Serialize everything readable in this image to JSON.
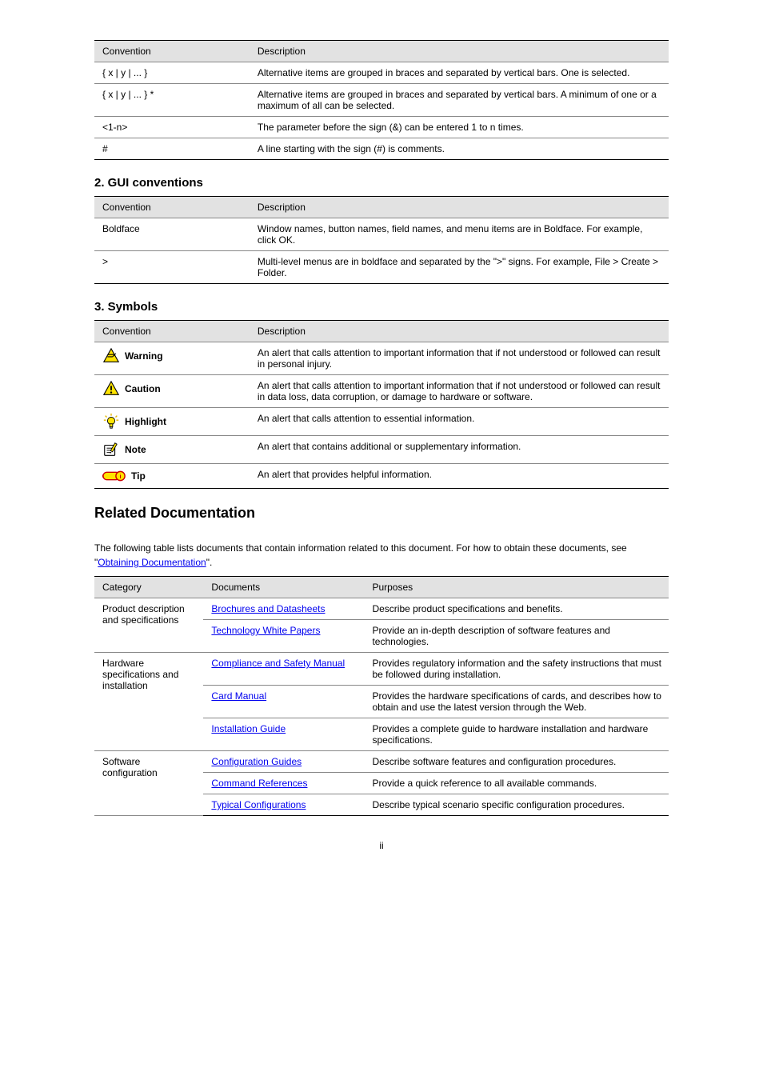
{
  "tables": {
    "conventions": {
      "headers": [
        "Convention",
        "Description"
      ],
      "rows": [
        [
          "{ x | y | ... }",
          "Alternative items are grouped in braces and separated by vertical bars. One is selected."
        ],
        [
          "{ x | y | ... } *",
          "Alternative items are grouped in braces and separated by vertical bars. A minimum of one or a maximum of all can be selected."
        ],
        [
          "<1-n>",
          "The parameter before the sign (&) can be entered 1 to n times."
        ],
        [
          "#",
          "A line starting with the sign (#) is comments."
        ]
      ]
    },
    "gui": {
      "title": "2. GUI conventions",
      "headers": [
        "Convention",
        "Description"
      ],
      "rows": [
        [
          "Boldface",
          "Window names, button names, field names, and menu items are in Boldface. For example, click OK."
        ],
        [
          ">",
          "Multi-level menus are in boldface and separated by the \">\" signs. For example, File > Create > Folder."
        ]
      ]
    },
    "symbols": {
      "title": "3. Symbols",
      "headers": [
        "Convention",
        "Description"
      ],
      "rows": [
        {
          "icon": "warning",
          "label": "Warning",
          "desc": "An alert that calls attention to important information that if not understood or followed can result in personal injury."
        },
        {
          "icon": "caution",
          "label": "Caution",
          "desc": "An alert that calls attention to important information that if not understood or followed can result in data loss, data corruption, or damage to hardware or software."
        },
        {
          "icon": "highlight",
          "label": "Highlight",
          "desc": "An alert that calls attention to essential information."
        },
        {
          "icon": "note",
          "label": "Note",
          "desc": "An alert that contains additional or supplementary information."
        },
        {
          "icon": "tip",
          "label": "Tip",
          "desc": "An alert that provides helpful information."
        }
      ]
    },
    "related": {
      "title": "Related Documentation",
      "intro": "The following table lists documents that contain information related to this document. For how to obtain these documents, see \"",
      "intro_link": "Obtaining Documentation",
      "intro_after": "\".",
      "headers": [
        "Category",
        "Documents",
        "Purposes"
      ],
      "rows": [
        {
          "category": "Product description and specifications",
          "docs": "Brochures and Datasheets",
          "purpose": "Describe product specifications and benefits.",
          "span_start": true
        },
        {
          "category": "",
          "docs": "Technology White Papers",
          "purpose": "Provide an in-depth description of software features and technologies."
        },
        {
          "category": "Hardware specifications and installation",
          "docs": "Compliance and Safety Manual",
          "purpose": "Provides regulatory information and the safety instructions that must be followed during installation.",
          "span_start": true
        },
        {
          "category": "",
          "docs": "Card Manual",
          "purpose": "Provides the hardware specifications of cards, and describes how to obtain and use the latest version through the Web."
        },
        {
          "category": "",
          "docs": "Installation Guide",
          "purpose": "Provides a complete guide to hardware installation and hardware specifications."
        },
        {
          "category": "Software configuration",
          "docs": "Configuration Guides",
          "purpose": "Describe software features and configuration procedures.",
          "span_start": true
        },
        {
          "category": "",
          "docs": "Command References",
          "purpose": "Provide a quick reference to all available commands."
        },
        {
          "category": "",
          "docs": "Typical Configurations",
          "purpose": "Describe typical scenario specific configuration procedures."
        }
      ]
    }
  },
  "footer": "ii"
}
